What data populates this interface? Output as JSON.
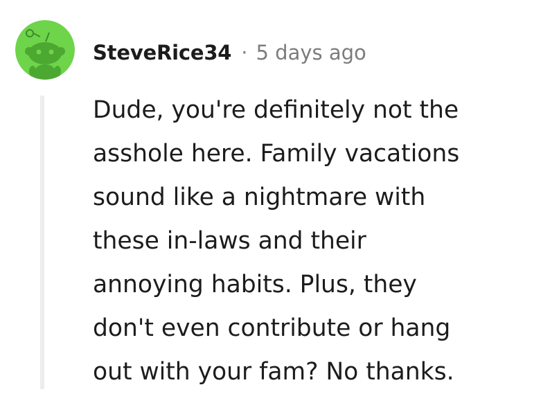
{
  "comment": {
    "author": "SteveRice34",
    "separator": "·",
    "timestamp": "5 days ago",
    "avatar_icon": "reddit-snoo-avatar-icon",
    "avatar_color": "#6ed44a",
    "body_lines": [
      "Dude, you're definitely not the",
      "asshole here. Family vacations",
      "sound like a nightmare with",
      "these in-laws and their",
      "annoying habits. Plus, they",
      "don't even contribute or hang",
      "out with your fam? No thanks."
    ]
  },
  "colors": {
    "text": "#1c1c1c",
    "muted": "#7c7c7c",
    "thread_line": "#ededed"
  }
}
